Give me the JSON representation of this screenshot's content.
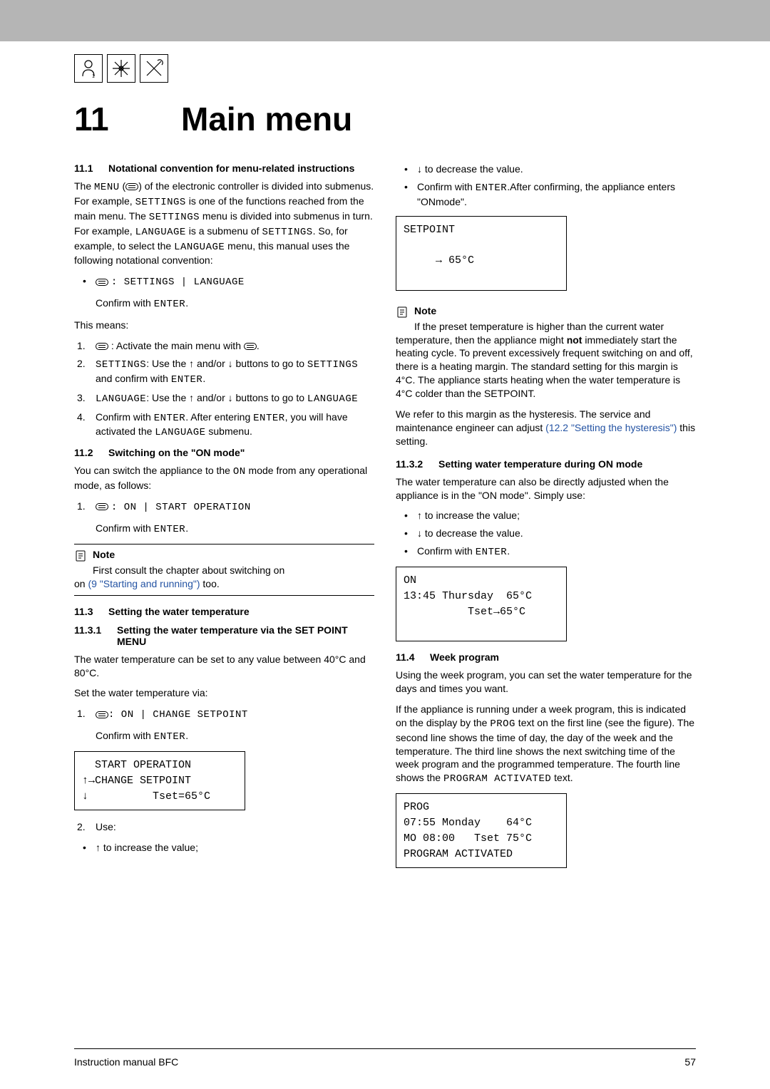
{
  "chapter": {
    "number": "11",
    "title": "Main menu"
  },
  "left": {
    "h11_1": {
      "num": "11.1",
      "title": "Notational convention for menu-related instructions"
    },
    "p1a": "The ",
    "p1b": " (",
    "p1c": ") of the electronic controller is divided into submenus. For example, ",
    "p1d": " is one of the functions reached from the main menu. The ",
    "p1e": " menu is divided into submenus in turn. For example, ",
    "p1f": " is a submenu of ",
    "p1g": ". So, for example, to select the ",
    "p1h": " menu, this manual uses the following notational convention:",
    "menu_word": "MENU",
    "settings_word": "SETTINGS",
    "language_word": "LANGUAGE",
    "bul1_path": ": SETTINGS | LANGUAGE",
    "confirm_enter": "Confirm with ",
    "enter_word": "ENTER",
    "this_means": "This means:",
    "step1_a": " : Activate the main menu with ",
    "step2_a": ": Use the ",
    "step2_b": " and/or ",
    "step2_c": " buttons to go to ",
    "step2_d": " and confirm with ",
    "step3_a": ": Use the ",
    "step3_b": " and/or ",
    "step3_c": " buttons to go to ",
    "step4_a": "Confirm with ",
    "step4_b": ". After entering ",
    "step4_c": ", you will have activated the ",
    "step4_d": " submenu.",
    "h11_2": {
      "num": "11.2",
      "title": "Switching on the \"ON mode\""
    },
    "p2_a": "You can switch the appliance to the ",
    "on_word": "ON",
    "p2_b": " mode from any operational mode, as follows:",
    "step_on": ": ON | START OPERATION",
    "note1_title": "Note",
    "note1_a": "First consult the chapter about switching on ",
    "note1_link": "(9 \"Starting and running\")",
    "note1_b": " too.",
    "h11_3": {
      "num": "11.3",
      "title": "Setting the water temperature"
    },
    "h11_3_1": {
      "num": "11.3.1",
      "title": "Setting the water temperature via the SET POINT MENU"
    },
    "p3": "The water temperature can be set to any value between 40°C and 80°C.",
    "p4": "Set the water temperature via:",
    "step_sp": ": ON | CHANGE SETPOINT",
    "disp1_l1": "  START OPERATION",
    "disp1_l2": "↑→CHANGE SETPOINT",
    "disp1_l3": "↓          Tset=65°C",
    "use_label": "Use:",
    "inc": " to increase the value;"
  },
  "right": {
    "dec": " to decrease the value.",
    "conf_a": "Confirm with ",
    "conf_b": ".After confirming, the appliance enters \"ONmode\".",
    "disp2_l1": "SETPOINT",
    "disp2_l2": "",
    "disp2_l3": "     → 65°C",
    "note2_title": "Note",
    "note2_body_a": "If the preset temperature is higher than the current water temperature, then the appliance might ",
    "note2_not": "not",
    "note2_body_b": " immediately start the heating cycle. To prevent excessively frequent switching on and off, there is a heating margin. The standard setting for this margin is 4°C. The appliance starts heating when the water temperature is 4°C colder than the SETPOINT.",
    "note2_body_c": "We refer to this margin as the hysteresis. The service and maintenance engineer can adjust ",
    "note2_link": "(12.2 \"Setting the hysteresis\")",
    "note2_body_d": " this setting.",
    "h11_3_2": {
      "num": "11.3.2",
      "title": "Setting water temperature during ON mode"
    },
    "p5": "The water temperature can also be directly adjusted when the appliance is in the \"ON mode\". Simply use:",
    "inc2": " to increase the value;",
    "dec2": " to decrease the value.",
    "conf2": "Confirm with ",
    "disp3_l1": "ON",
    "disp3_l2": "13:45 Thursday  65°C",
    "disp3_l3": "          Tset→65°C",
    "h11_4": {
      "num": "11.4",
      "title": "Week program"
    },
    "p6": "Using the week program, you can set the water temperature for the days and times you want.",
    "p7_a": "If the appliance is running under a week program, this is indicated on the display by the ",
    "prog_word": "PROG",
    "p7_b": " text on the first line (see the figure). The second line shows the time of day, the day of the week and the temperature. The third line shows the next switching time of the week program and the programmed temperature. The fourth line shows the ",
    "pa_word": "PROGRAM ACTIVATED",
    "p7_c": " text.",
    "disp4_l1": "PROG",
    "disp4_l2": "07:55 Monday    64°C",
    "disp4_l3": "MO 08:00   Tset 75°C",
    "disp4_l4": "PROGRAM ACTIVATED"
  },
  "footer": {
    "left": "Instruction manual BFC",
    "right": "57"
  }
}
